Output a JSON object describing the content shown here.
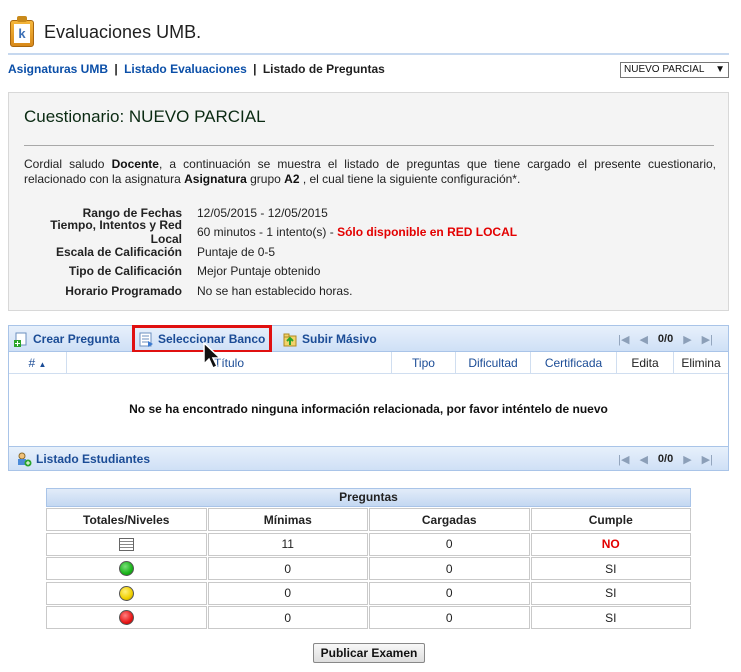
{
  "app": {
    "title": "Evaluaciones UMB."
  },
  "breadcrumb": {
    "items": [
      "Asignaturas UMB",
      "Listado Evaluaciones"
    ],
    "current": "Listado de Preguntas",
    "separator": "|"
  },
  "parcial_select": {
    "value": "NUEVO PARCIAL"
  },
  "info": {
    "title": "Cuestionario: NUEVO PARCIAL",
    "intro_parts": [
      "Cordial saludo ",
      "Docente",
      ", a continuación se muestra el listado de preguntas que tiene cargado el presente cuestionario, relacionado con la asignatura ",
      "Asignatura",
      " grupo ",
      "A2",
      " , el cual tiene la siguiente configuración*."
    ],
    "config": [
      {
        "label": "Rango de Fechas",
        "value": "12/05/2015 - 12/05/2015",
        "extra": ""
      },
      {
        "label": "Tiempo, Intentos y Red Local",
        "value": "60 minutos - 1 intento(s) - ",
        "extra": "Sólo disponible en RED LOCAL"
      },
      {
        "label": "Escala de Calificación",
        "value": "Puntaje de 0-5",
        "extra": ""
      },
      {
        "label": "Tipo de Calificación",
        "value": "Mejor Puntaje obtenido",
        "extra": ""
      },
      {
        "label": "Horario Programado",
        "value": "No se han establecido horas.",
        "extra": ""
      }
    ]
  },
  "toolbar": {
    "crear": "Crear Pregunta",
    "seleccionar": "Seleccionar Banco",
    "subir": "Subir Másivo",
    "pager_count": "0/0"
  },
  "columns": [
    "#",
    "Título",
    "Tipo",
    "Dificultad",
    "Certificada",
    "Edita",
    "Elimina"
  ],
  "empty_message": "No se ha encontrado ninguna información relacionada, por favor inténtelo de nuevo",
  "footer": {
    "estudiantes": "Listado Estudiantes",
    "pager_count": "0/0"
  },
  "stats": {
    "caption": "Preguntas",
    "headers": [
      "Totales/Niveles",
      "Mínimas",
      "Cargadas",
      "Cumple"
    ],
    "rows": [
      {
        "level_icon": "list-icon",
        "minimas": "11",
        "cargadas": "0",
        "cumple": "NO"
      },
      {
        "level_icon": "green-dot-icon",
        "minimas": "0",
        "cargadas": "0",
        "cumple": "SI"
      },
      {
        "level_icon": "yellow-dot-icon",
        "minimas": "0",
        "cargadas": "0",
        "cumple": "SI"
      },
      {
        "level_icon": "red-dot-icon",
        "minimas": "0",
        "cargadas": "0",
        "cumple": "SI"
      }
    ]
  },
  "colors": {
    "link": "#0b4fa8",
    "alert": "#e30000",
    "green": "#19b319",
    "yellow": "#f0d000",
    "red": "#e81818"
  },
  "publish_button": "Publicar Examen"
}
